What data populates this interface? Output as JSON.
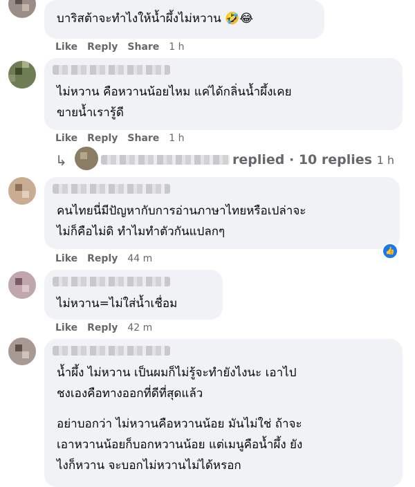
{
  "comments": [
    {
      "text_lines": [
        "บาริสต้าจะทำไงให้น้ำผึ้งไม่หวาน 🤣😂"
      ],
      "actions": {
        "like": "Like",
        "reply": "Reply",
        "share": "Share",
        "time": "1 h"
      }
    },
    {
      "text_lines": [
        "ไม่หวาน คือหวานน้อยไหม แค่ได้กลิ่นน้ำผึ้งเคย",
        "ขายน้ำเรารู้ดี"
      ],
      "actions": {
        "like": "Like",
        "reply": "Reply",
        "share": "Share",
        "time": "1 h"
      },
      "replies": {
        "arrow": "↳",
        "label": "replied · 10 replies",
        "time": "1 h"
      }
    },
    {
      "text_lines": [
        "คนไทยนี่มีปัญหากับการอ่านภาษาไทยหรือเปล่าจะ",
        "ไม่ก็คือไม่ดิ ทำไมทำตัวกันแปลกๆ"
      ],
      "actions": {
        "like": "Like",
        "reply": "Reply",
        "time": "44 m"
      },
      "reaction_icon": "thumbs-up-icon"
    },
    {
      "text_lines": [
        "ไม่หวาน=ไม่ใส่น้ำเชื่อม"
      ],
      "actions": {
        "like": "Like",
        "reply": "Reply",
        "time": "42 m"
      }
    },
    {
      "text_lines": [
        "น้ำผึ้ง ไม่หวาน เป็นผมก็ไม่รู้จะทำยังไงนะ เอาไป",
        "ชงเองคือทางออกที่ดีที่สุดแล้ว"
      ],
      "text_lines_2": [
        "อย่าบอกว่า ไม่หวานคือหวานน้อย มันไม่ใช่ ถ้าจะ",
        "เอาหวานน้อยก็บอกหวานน้อย แต่เมนูคือน้ำผึ้ง ยัง",
        "ไงก็หวาน จะบอกไม่หวานไม่ได้หรอก"
      ]
    }
  ],
  "colors": {
    "bubble": "#f0f2f5",
    "meta": "#65676b",
    "like_blue": "#1877f2"
  }
}
